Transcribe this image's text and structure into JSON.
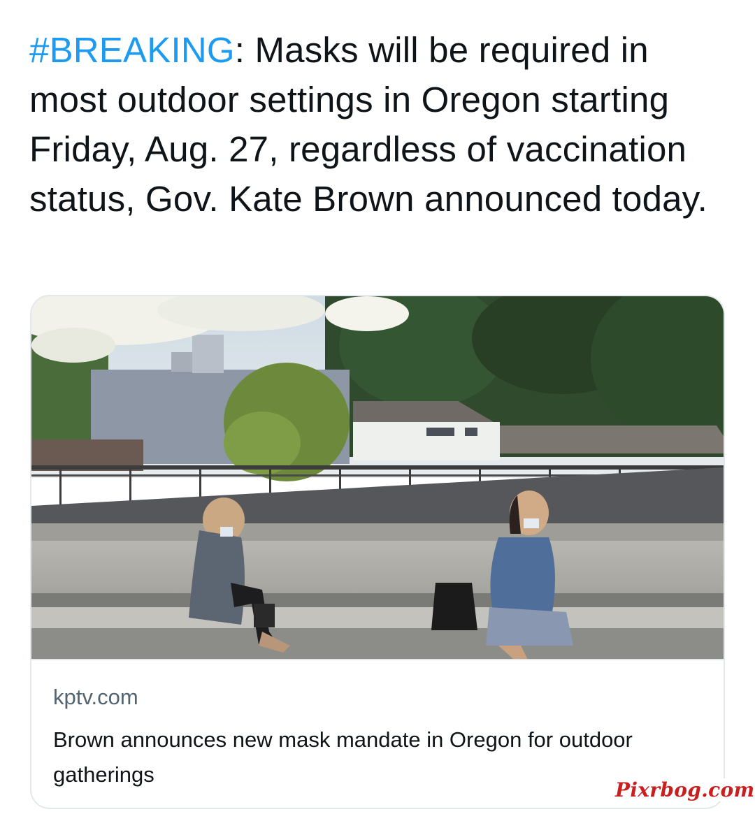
{
  "tweet": {
    "hashtag": "#BREAKING",
    "text": ": Masks will be required in most outdoor settings in Oregon starting Friday, Aug. 27, regardless of vaccination status, Gov. Kate Brown announced today."
  },
  "card": {
    "image_alt": "Two women wearing face masks sitting apart on a concrete ledge outdoors",
    "domain": "kptv.com",
    "title": "Brown announces new mask mandate in Oregon for outdoor gatherings"
  },
  "watermark": {
    "text": "Pixrbog.com"
  },
  "colors": {
    "hashtag": "#1d9bf0",
    "text": "#0f1419",
    "secondary_text": "#536471",
    "card_border": "#e3e8ec",
    "watermark": "#c91f1f"
  }
}
